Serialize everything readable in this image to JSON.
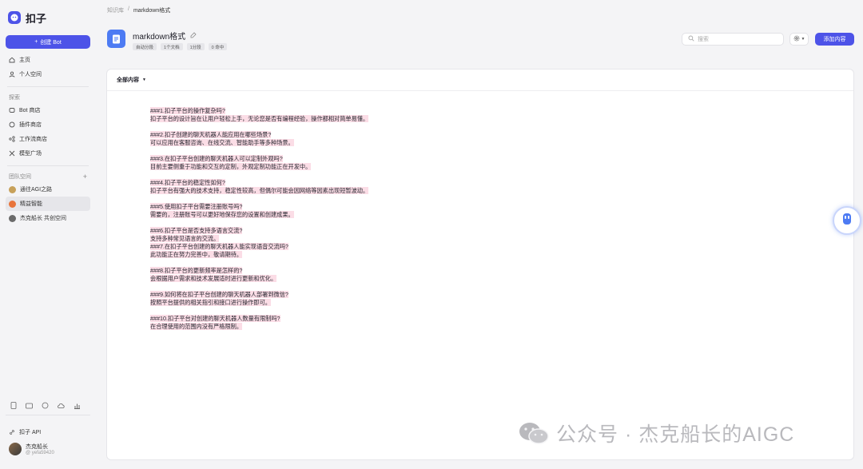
{
  "app": {
    "brand": "扣子",
    "create_label": "创建 Bot"
  },
  "sidebar": {
    "main_items": [
      {
        "label": "主页",
        "icon": "home-icon"
      },
      {
        "label": "个人空间",
        "icon": "user-icon"
      }
    ],
    "explore_label": "探索",
    "explore_items": [
      {
        "label": "Bot 商店",
        "icon": "bot-store-icon"
      },
      {
        "label": "插件商店",
        "icon": "plugin-store-icon"
      },
      {
        "label": "工作流商店",
        "icon": "workflow-store-icon"
      },
      {
        "label": "模型广场",
        "icon": "model-square-icon"
      }
    ],
    "team_label": "团队空间",
    "team_items": [
      {
        "label": "通往AGI之路",
        "color": "#c7a15a"
      },
      {
        "label": "精益智能",
        "color": "#e8743b",
        "active": true
      },
      {
        "label": "杰克船长 共创空间",
        "color": "#6b6b6b"
      }
    ],
    "api_label": "扣子 API",
    "user": {
      "name": "杰克船长",
      "id": "@ yefa59420"
    }
  },
  "breadcrumb": {
    "parent": "知识库",
    "separator": "/",
    "current": "markdown格式"
  },
  "header": {
    "title": "markdown格式",
    "tags": [
      "自动分段",
      "1个文档",
      "1分段",
      "0 命中"
    ],
    "search_placeholder": "搜索",
    "add_label": "添加内容"
  },
  "panel": {
    "filter_label": "全部内容"
  },
  "content_blocks": [
    [
      "###1.扣子平台的操作复杂吗?",
      "扣子平台的设计旨在让用户轻松上手，无论您是否有编程经验，操作都相对简单易懂。"
    ],
    [
      "###2.扣子创建的聊天机器人能应用在哪些场景?",
      "可以应用在客服咨询、在线交流、智能助手等多种场景。"
    ],
    [
      "###3.在扣子平台创建的聊天机器人可以定制外观吗?",
      "目前主要侧重于功能和交互的定制，外观定制功能正在开发中。"
    ],
    [
      "###4.扣子平台的稳定性如何?",
      "扣子平台有强大的技术支持，稳定性较高，但偶尔可能会因网络等因素出现短暂波动。"
    ],
    [
      "###5.使用扣子平台需要注册账号吗?",
      "需要的，注册账号可以更好地保存您的设置和创建成果。"
    ],
    [
      "###6.扣子平台是否支持多语言交流?",
      "支持多种常见语言的交流。",
      "###7.在扣子平台创建的聊天机器人能实现语音交流吗?",
      "此功能正在努力完善中，敬请期待。"
    ],
    [
      "###8.扣子平台的更新频率是怎样的?",
      "会根据用户需求和技术发展适时进行更新和优化。"
    ],
    [
      "###9.如何将在扣子平台创建的聊天机器人部署到微信?",
      "按照平台提供的相关指引和接口进行操作即可。"
    ],
    [
      "###10.扣子平台对创建的聊天机器人数量有限制吗?",
      "在合理使用的范围内没有严格限制。"
    ]
  ],
  "watermark": "公众号 · 杰克船长的AIGC",
  "colors": {
    "accent": "#4d53e8",
    "highlight": "#fbdde6",
    "doc_icon": "#4d7bf3"
  }
}
